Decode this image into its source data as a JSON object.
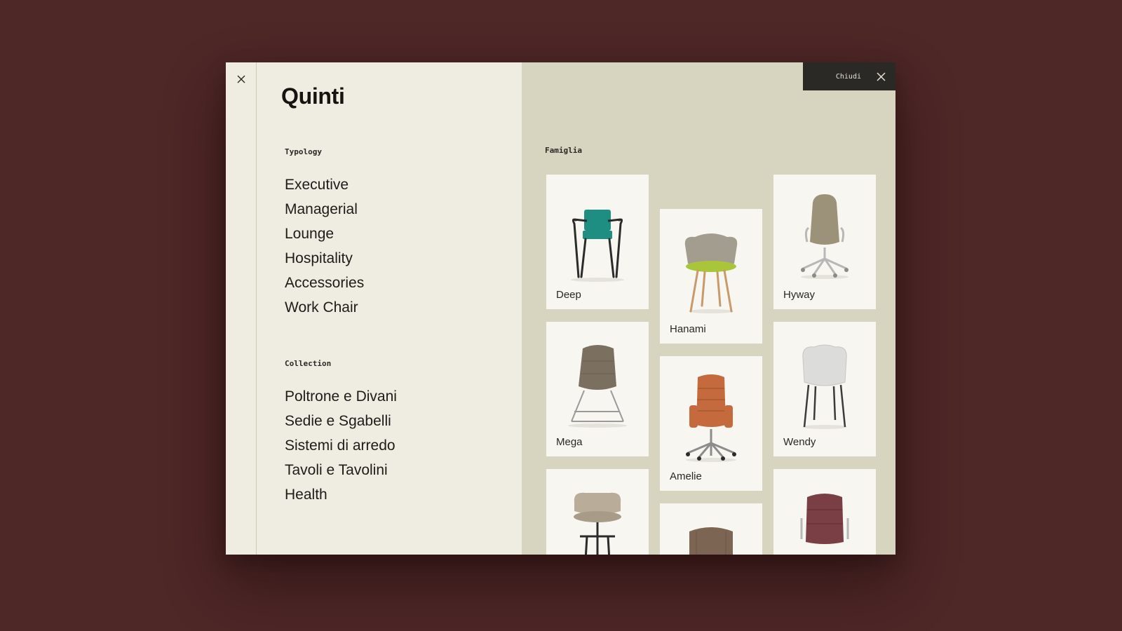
{
  "brand": "Quinti",
  "rail": {
    "close_icon": "close-icon"
  },
  "typology": {
    "label": "Typology",
    "items": [
      "Executive",
      "Managerial",
      "Lounge",
      "Hospitality",
      "Accessories",
      "Work Chair"
    ]
  },
  "collection": {
    "label": "Collection",
    "items": [
      "Poltrone e Divani",
      "Sedie e Sgabelli",
      "Sistemi di arredo",
      "Tavoli e Tavolini",
      "Health"
    ]
  },
  "close_bar": {
    "label": "Chiudi",
    "icon": "close-icon"
  },
  "famiglia": {
    "label": "Famiglia",
    "cards": [
      {
        "name": "Deep",
        "seat_color": "#1e8e82"
      },
      {
        "name": "Hanami",
        "seat_color": "#a39d90"
      },
      {
        "name": "Hyway",
        "seat_color": "#9b9279"
      },
      {
        "name": "Mega",
        "seat_color": "#7b6f5f"
      },
      {
        "name": "Amelie",
        "seat_color": "#c46a3c"
      },
      {
        "name": "Wendy",
        "seat_color": "#dcdcda"
      },
      {
        "name": "",
        "seat_color": "#b9ac98"
      },
      {
        "name": "",
        "seat_color": "#7c6552"
      },
      {
        "name": "",
        "seat_color": "#7a3e45"
      }
    ]
  },
  "colors": {
    "background": "#4e2727",
    "left_panel": "#efede1",
    "right_panel": "#d7d4bf",
    "card": "#f7f6f1",
    "close_bar": "#2a2925"
  }
}
